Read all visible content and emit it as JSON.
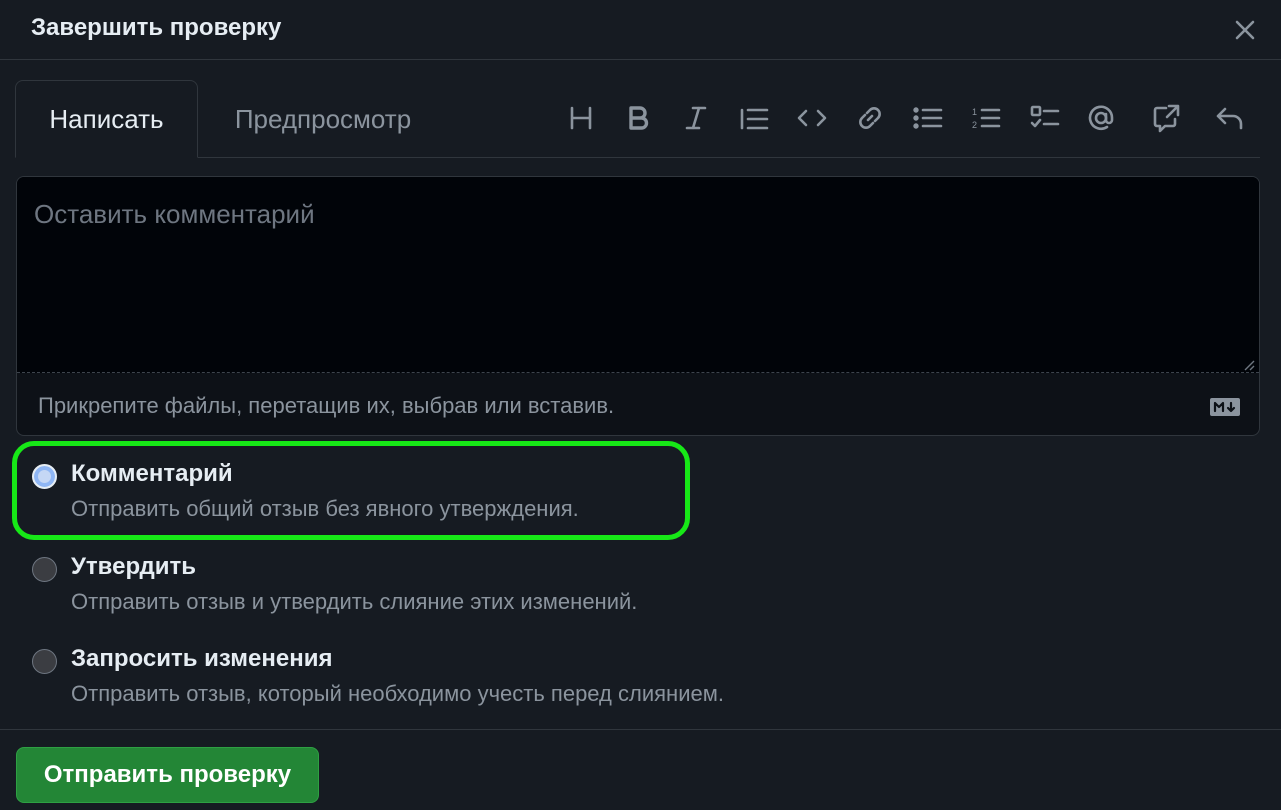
{
  "dialog": {
    "title": "Завершить проверку",
    "close_icon": "x-icon"
  },
  "editor": {
    "tabs": [
      {
        "label": "Написать",
        "active": true
      },
      {
        "label": "Предпросмотр",
        "active": false
      }
    ],
    "toolbar": [
      "heading-icon",
      "bold-icon",
      "italic-icon",
      "quote-icon",
      "code-icon",
      "link-icon",
      "bulleted-list-icon",
      "numbered-list-icon",
      "task-list-icon",
      "mention-icon",
      "cross-reference-icon",
      "reply-icon"
    ],
    "placeholder": "Оставить комментарий",
    "value": "",
    "attach_hint": "Прикрепите файлы, перетащив их, выбрав или вставив.",
    "markdown_icon": "markdown-icon"
  },
  "review_options": [
    {
      "label": "Комментарий",
      "description": "Отправить общий отзыв без явного утверждения.",
      "selected": true
    },
    {
      "label": "Утвердить",
      "description": "Отправить отзыв и утвердить слияние этих изменений.",
      "selected": false
    },
    {
      "label": "Запросить изменения",
      "description": "Отправить отзыв, который необходимо учесть перед слиянием.",
      "selected": false
    }
  ],
  "submit_label": "Отправить проверку",
  "colors": {
    "background": "#161b22",
    "primary_button": "#238636",
    "highlight": "#17e817"
  }
}
